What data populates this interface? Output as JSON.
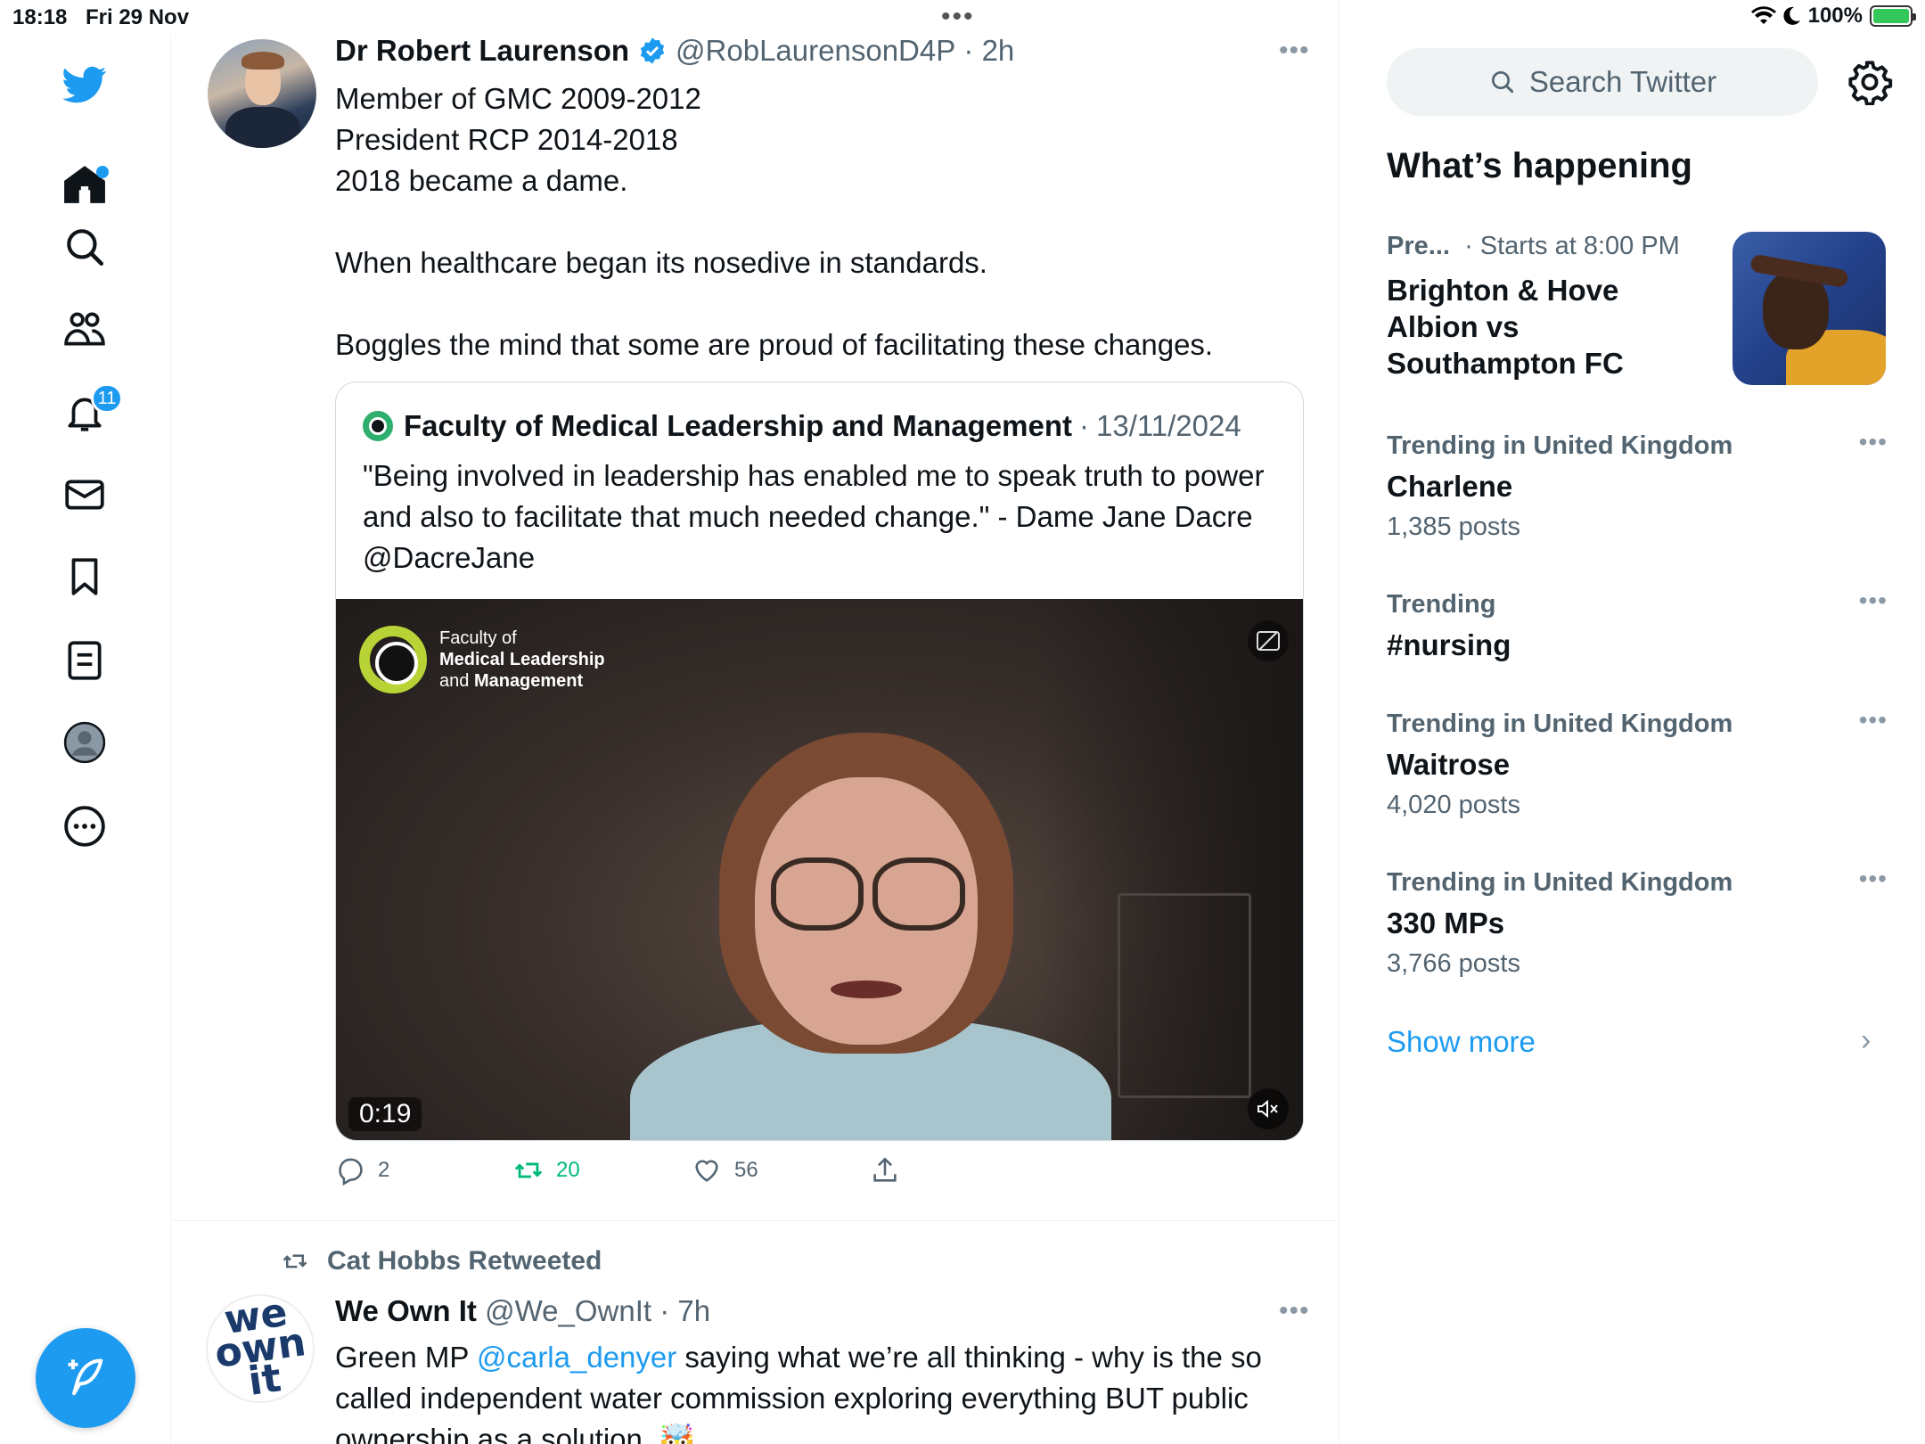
{
  "status_bar": {
    "time": "18:18",
    "date": "Fri 29 Nov",
    "battery": "100%"
  },
  "nav": {
    "notifications_badge": "11"
  },
  "tweet1": {
    "name": "Dr Robert Laurenson",
    "handle": "@RobLaurensonD4P",
    "time": "2h",
    "lines": [
      "Member of GMC 2009-2012",
      "President RCP 2014-2018",
      "2018 became a dame.",
      "When healthcare began its nosedive in standards.",
      "Boggles the mind that some are proud of facilitating these changes."
    ],
    "quote": {
      "name": "Faculty of Medical Leadership and Management",
      "date": "13/11/2024",
      "text": "\"Being involved in leadership has enabled me to speak truth to power and also to facilitate that much needed change.\" - Dame Jane Dacre @DacreJane",
      "video_logo_line1": "Faculty of",
      "video_logo_line2": "Medical Leadership",
      "video_logo_line3_a": "and",
      "video_logo_line3_b": "Management",
      "video_duration": "0:19"
    },
    "replies": "2",
    "retweets": "20",
    "likes": "56"
  },
  "tweet2": {
    "retweeted_by": "Cat Hobbs Retweeted",
    "avatar_text_1": "we",
    "avatar_text_2": "own",
    "avatar_text_3": "it",
    "name": "We Own It",
    "handle": "@We_OwnIt",
    "time": "7h",
    "text_a": "Green MP ",
    "mention": "@carla_denyer",
    "text_b": " saying what we’re all thinking - why is the so called independent water commission  exploring everything BUT public ownership as a solution. 🤯"
  },
  "right": {
    "search_placeholder": "Search Twitter",
    "title": "What’s happening",
    "live": {
      "label": "Pre...",
      "starts": "· Starts at 8:00 PM",
      "title": "Brighton & Hove Albion vs Southampton FC"
    },
    "trends": [
      {
        "label": "Trending in United Kingdom",
        "name": "Charlene",
        "count": "1,385 posts"
      },
      {
        "label": "Trending",
        "name": "#nursing",
        "count": ""
      },
      {
        "label": "Trending in United Kingdom",
        "name": "Waitrose",
        "count": "4,020 posts"
      },
      {
        "label": "Trending in United Kingdom",
        "name": "330 MPs",
        "count": "3,766 posts"
      }
    ],
    "show_more": "Show more"
  },
  "colors": {
    "accent": "#1d9bf0",
    "retweet": "#00ba7c",
    "muted": "#536471"
  }
}
